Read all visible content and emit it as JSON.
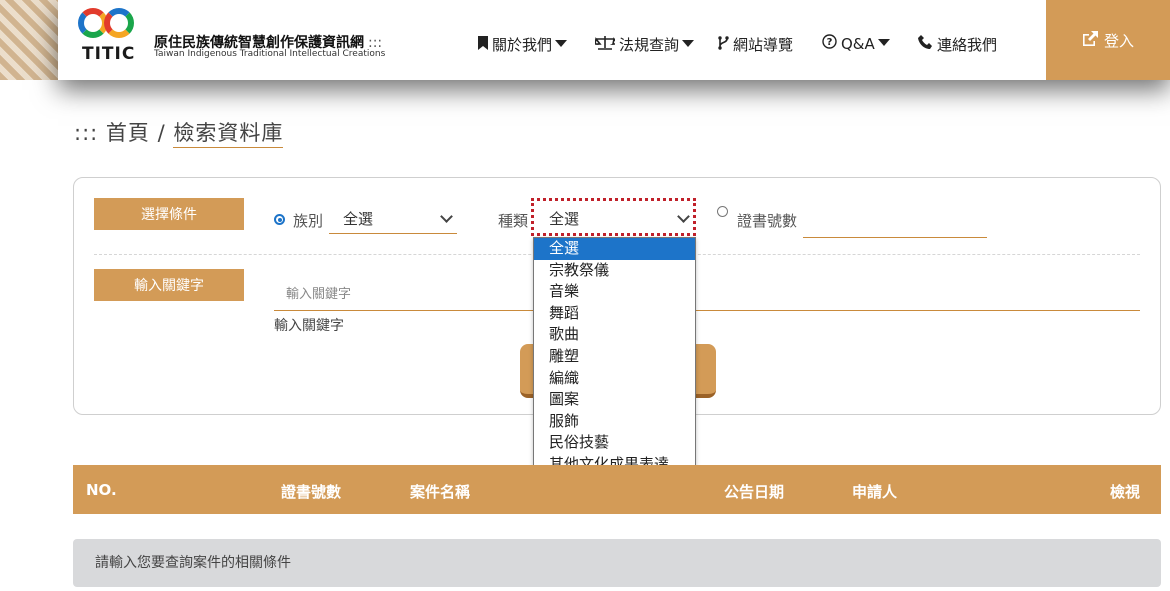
{
  "header": {
    "logo_text": "TITIC",
    "site_name": "原住民族傳統智慧創作保護資訊網",
    "site_name_suffix": ":::",
    "site_subtitle": "Taiwan Indigenous Traditional Intellectual Creations",
    "nav": [
      {
        "label": "關於我們",
        "icon": "bookmark-icon",
        "glyph": "🔖",
        "has_caret": true
      },
      {
        "label": "法規查詢",
        "icon": "scales-icon",
        "glyph": "⚖",
        "has_caret": true
      },
      {
        "label": "網站導覽",
        "icon": "sitemap-icon",
        "glyph": "⑂",
        "has_caret": false
      },
      {
        "label": "Q&A",
        "icon": "question-icon",
        "glyph": "?",
        "has_caret": true
      },
      {
        "label": "連絡我們",
        "icon": "phone-icon",
        "glyph": "✆",
        "has_caret": false
      }
    ],
    "login_label": "登入",
    "login_icon": "share-square-icon"
  },
  "breadcrumb": {
    "prefix": ":::",
    "home": "首頁",
    "separator": "/",
    "current": "檢索資料庫"
  },
  "search": {
    "condition_label": "選擇條件",
    "ethnic_radio_label": "族別",
    "ethnic_selected": "全選",
    "type_label": "種類",
    "type_selected": "全選",
    "certificate_radio_label": "證書號數",
    "keyword_label": "輸入關鍵字",
    "keyword_placeholder": "輸入關鍵字",
    "keyword_value": "",
    "keyword_hint": "輸入關鍵字",
    "type_options": [
      "全選",
      "宗教祭儀",
      "音樂",
      "舞蹈",
      "歌曲",
      "雕塑",
      "編織",
      "圖案",
      "服飾",
      "民俗技藝",
      "其他文化成果表達"
    ],
    "type_highlighted": "全選"
  },
  "table": {
    "columns": [
      "NO.",
      "證書號數",
      "案件名稱",
      "公告日期",
      "申請人",
      "檢視"
    ],
    "empty_message": "請輸入您要查詢案件的相關條件"
  },
  "colors": {
    "accent": "#d39b57",
    "focus": "#c0202a",
    "selected_option": "#1d74c9"
  }
}
